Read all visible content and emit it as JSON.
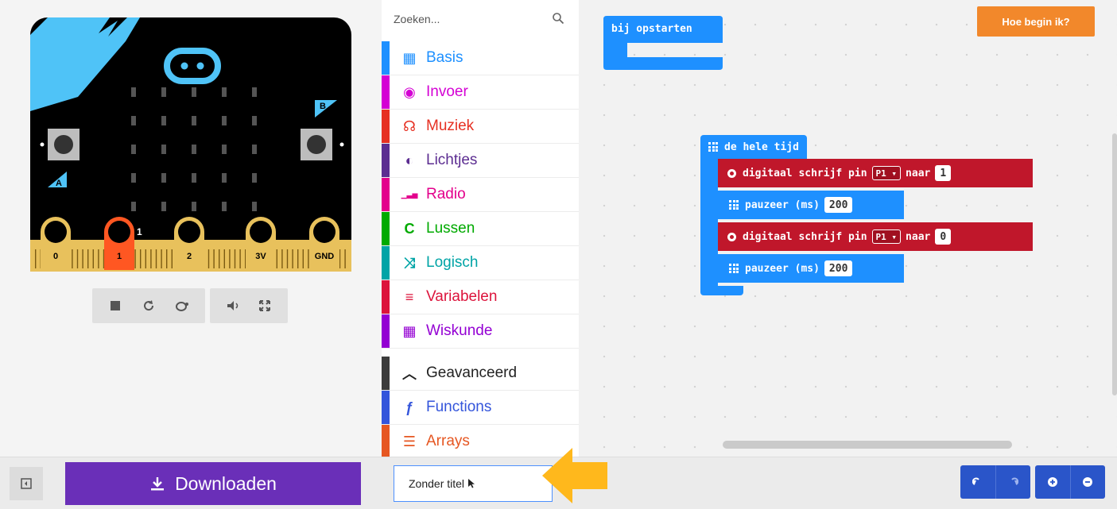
{
  "simulator": {
    "button_a_label": "A",
    "button_b_label": "B",
    "pins": [
      {
        "label": "0"
      },
      {
        "label": "1",
        "active": true
      },
      {
        "label": "2"
      },
      {
        "label": "3V"
      },
      {
        "label": "GND"
      }
    ],
    "pin_indicator": "1",
    "toolbar_icons": [
      "stop-icon",
      "restart-icon",
      "slowmo-icon",
      "sound-icon",
      "fullscreen-icon"
    ]
  },
  "toolbox": {
    "search_placeholder": "Zoeken...",
    "categories": [
      {
        "label": "Basis",
        "color": "#1e90ff",
        "icon": "grid-icon"
      },
      {
        "label": "Invoer",
        "color": "#d400d4",
        "icon": "target-icon"
      },
      {
        "label": "Muziek",
        "color": "#e63022",
        "icon": "headphones-icon"
      },
      {
        "label": "Lichtjes",
        "color": "#5c2d91",
        "icon": "toggle-icon"
      },
      {
        "label": "Radio",
        "color": "#e3008c",
        "icon": "signal-icon"
      },
      {
        "label": "Lussen",
        "color": "#00aa00",
        "icon": "refresh-icon"
      },
      {
        "label": "Logisch",
        "color": "#00a4a6",
        "icon": "shuffle-icon"
      },
      {
        "label": "Variabelen",
        "color": "#dc143c",
        "icon": "list-icon"
      },
      {
        "label": "Wiskunde",
        "color": "#9400d3",
        "icon": "calculator-icon"
      }
    ],
    "advanced": [
      {
        "label": "Geavanceerd",
        "color": "#3c3c3c",
        "icon": "chevron-up-icon"
      },
      {
        "label": "Functions",
        "color": "#3455db",
        "icon": "function-icon"
      },
      {
        "label": "Arrays",
        "color": "#e65722",
        "icon": "array-icon"
      }
    ]
  },
  "workspace": {
    "help_button": "Hoe begin ik?",
    "on_start": "bij opstarten",
    "forever": "de hele tijd",
    "blocks": [
      {
        "kind": "digital",
        "text": "digitaal schrijf pin",
        "pin": "P1",
        "to": "naar",
        "value": "1"
      },
      {
        "kind": "pause",
        "text": "pauzeer (ms)",
        "value": "200"
      },
      {
        "kind": "digital",
        "text": "digitaal schrijf pin",
        "pin": "P1",
        "to": "naar",
        "value": "0"
      },
      {
        "kind": "pause",
        "text": "pauzeer (ms)",
        "value": "200"
      }
    ]
  },
  "bottom_bar": {
    "download_label": "Downloaden",
    "project_name": "Zonder titel"
  },
  "colors": {
    "block_blue": "#1e90ff",
    "block_red": "#c0172b",
    "download_purple": "#6a2fb8",
    "help_orange": "#f2882b",
    "board_black": "#000000",
    "board_cyan": "#4fc3f7",
    "pin_gold": "#e8c15c",
    "pin_active": "#ff5722",
    "arrow_yellow": "#ffb81c"
  }
}
